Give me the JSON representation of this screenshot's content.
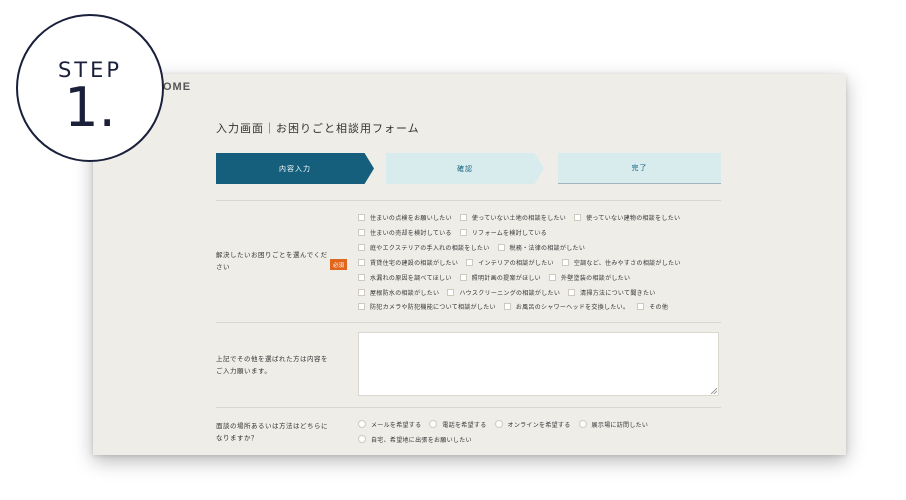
{
  "header": {
    "logo_fragment": "OME"
  },
  "badge": {
    "step_word": "STEP",
    "step_number": "1."
  },
  "form": {
    "title": "入力画面｜お困りごと相談用フォーム",
    "steps": [
      "内容入力",
      "確認",
      "完了"
    ],
    "q1": {
      "label_line1": "解決したいお困りごとを選んでくだ",
      "label_line2": "さい",
      "required": "必須",
      "rows": [
        [
          "住まいの点検をお願いしたい",
          "使っていない土地の相談をしたい",
          "使っていない建物の相談をしたい"
        ],
        [
          "住まいの売却を検討している",
          "リフォームを検討している"
        ],
        [
          "庭やエクステリアの手入れの相談をしたい",
          "税務・法律の相談がしたい"
        ],
        [
          "賃貸住宅の建設の相談がしたい",
          "インテリアの相談がしたい",
          "空調など、住みやすさの相談がしたい"
        ],
        [
          "水漏れの原因を調べてほしい",
          "照明計画の提案がほしい",
          "外壁塗装の相談がしたい"
        ],
        [
          "屋根防水の相談がしたい",
          "ハウスクリーニングの相談がしたい",
          "清掃方法について聞きたい"
        ],
        [
          "防犯カメラや防犯機能について相談がしたい",
          "お風呂のシャワーヘッドを交換したい。",
          "その他"
        ]
      ]
    },
    "q2": {
      "label_line1": "上記でその他を選ばれた方は内容を",
      "label_line2": "ご入力願います。",
      "value": ""
    },
    "q3": {
      "label_line1": "面談の場所あるいは方法はどちらに",
      "label_line2": "なりますか？",
      "rows": [
        [
          "メールを希望する",
          "電話を希望する",
          "オンラインを希望する",
          "展示場に訪問したい"
        ],
        [
          "自宅、希望地に出張をお願いしたい"
        ]
      ]
    }
  }
}
